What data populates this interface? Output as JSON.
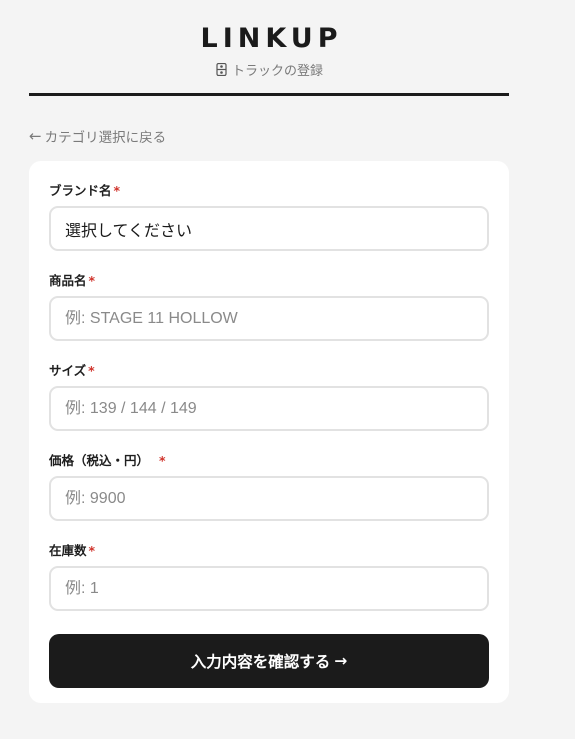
{
  "header": {
    "logo": "LINKUP",
    "subtitle": "トラックの登録",
    "subtitle_icon": "track-icon"
  },
  "back_link": {
    "arrow": "←",
    "label": "カテゴリ選択に戻る"
  },
  "form": {
    "brand": {
      "label": "ブランド名",
      "required": "*",
      "value": "選択してください"
    },
    "product": {
      "label": "商品名",
      "required": "*",
      "placeholder": "例: STAGE 11 HOLLOW"
    },
    "size": {
      "label": "サイズ",
      "required": "*",
      "placeholder": "例: 139 / 144 / 149"
    },
    "price": {
      "label": "価格（税込・円）",
      "required": "*",
      "placeholder": "例: 9900"
    },
    "stock": {
      "label": "在庫数",
      "required": "*",
      "placeholder": "例: 1"
    },
    "submit": {
      "label": "入力内容を確認する",
      "arrow": "→"
    }
  },
  "colors": {
    "background": "#f4f4f4",
    "card": "#ffffff",
    "primary": "#1b1b1b",
    "required": "#d0342c",
    "muted": "#7a7a7a"
  }
}
